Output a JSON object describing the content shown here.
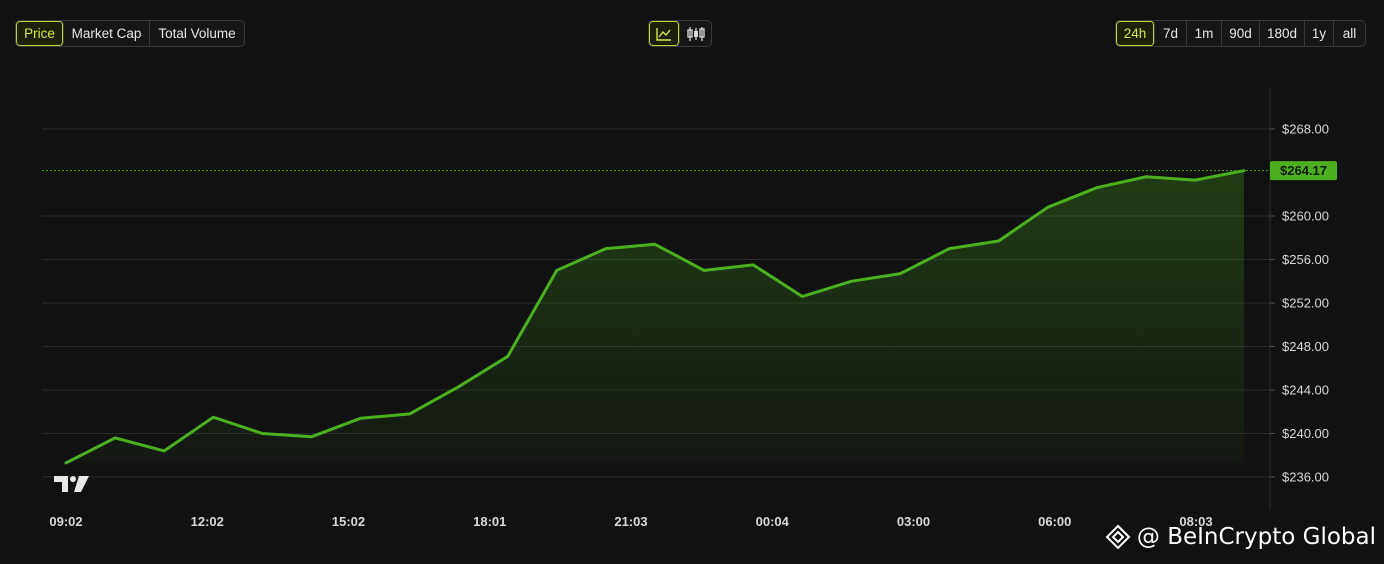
{
  "metric_tabs": [
    {
      "label": "Price",
      "active": true
    },
    {
      "label": "Market Cap",
      "active": false
    },
    {
      "label": "Total Volume",
      "active": false
    }
  ],
  "view_toggle": {
    "active": "line-chart-icon",
    "icons": [
      "line-chart-icon",
      "candlestick-icon"
    ]
  },
  "range_tabs": [
    {
      "label": "24h",
      "active": true
    },
    {
      "label": "7d",
      "active": false
    },
    {
      "label": "1m",
      "active": false
    },
    {
      "label": "90d",
      "active": false
    },
    {
      "label": "180d",
      "active": false
    },
    {
      "label": "1y",
      "active": false
    },
    {
      "label": "all",
      "active": false
    }
  ],
  "watermark": {
    "text": "@ BeInCrypto Global"
  },
  "colors": {
    "line": "#4caf1f",
    "accent": "#d7e84a",
    "price_tag": "#4caf1f",
    "grid": "#2a2a2a"
  },
  "chart_data": {
    "type": "area",
    "title": "",
    "xlabel": "",
    "ylabel": "",
    "x_ticks": [
      "09:02",
      "12:02",
      "15:02",
      "18:01",
      "21:03",
      "00:04",
      "03:00",
      "06:00",
      "08:03"
    ],
    "y_ticks": [
      "$236.00",
      "$240.00",
      "$244.00",
      "$248.00",
      "$252.00",
      "$256.00",
      "$260.00",
      "$264.17",
      "$268.00"
    ],
    "ylim": [
      232,
      272
    ],
    "grid": true,
    "last_price_label": "$264.17",
    "series": [
      {
        "values": [
          237.3,
          239.6,
          238.4,
          241.5,
          240.0,
          239.7,
          241.4,
          241.8,
          244.3,
          247.1,
          255.0,
          257.0,
          257.4,
          255.0,
          255.5,
          252.6,
          254.0,
          254.7,
          257.0,
          257.7,
          260.8,
          262.6,
          263.6,
          263.3,
          264.17
        ]
      }
    ]
  }
}
